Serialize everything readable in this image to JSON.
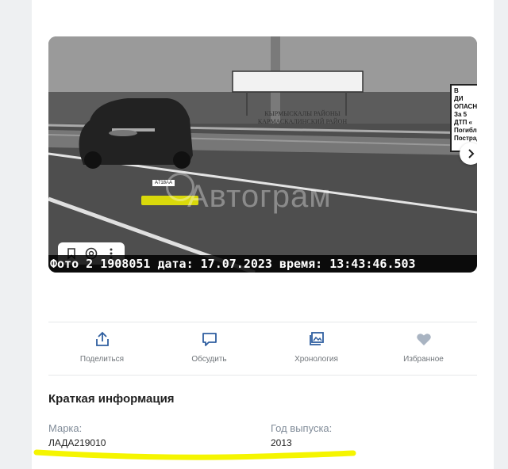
{
  "photo": {
    "caption": "Фото 2 1908051 дата: 17.07.2023 время: 13:43:46.503",
    "watermark": "Автограм",
    "sign_lines": [
      "КЫРМЫСКАЛЫ РАЙОНЫ",
      "КАРМАСКАЛИНСКИЙ РАЙОН"
    ],
    "warning_sign_lines": [
      "В",
      "ДИ",
      "ОПАСН",
      "За 5",
      "ДТП «",
      "Погибл",
      "Пострад"
    ],
    "plate_text": "А718АА",
    "highlight_color": "#f2f200"
  },
  "photo_tools": {
    "icons": [
      "bookmark-icon",
      "search-plate-icon",
      "more-vertical-icon"
    ]
  },
  "actions": [
    {
      "label": "Поделиться",
      "icon": "share-icon"
    },
    {
      "label": "Обсудить",
      "icon": "comment-icon"
    },
    {
      "label": "Хронология",
      "icon": "gallery-icon"
    },
    {
      "label": "Избранное",
      "icon": "heart-icon"
    }
  ],
  "info": {
    "title": "Краткая информация",
    "brand_label": "Марка:",
    "brand_value": "ЛАДА219010",
    "year_label": "Год выпуска:",
    "year_value": "2013"
  }
}
